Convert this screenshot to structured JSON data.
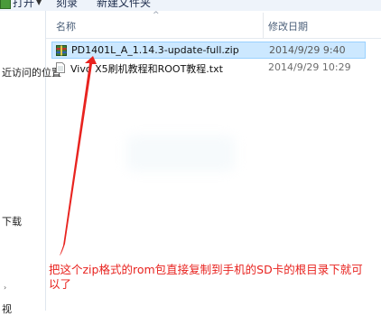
{
  "toolbar": {
    "open_label": "打开",
    "open_dropdown": "▼",
    "share_label": "刻录",
    "new_folder_label": "新建文件夹"
  },
  "sidebar": {
    "recent_places": "近访问的位置",
    "downloads": "下载",
    "item_bottom": "视"
  },
  "columns": {
    "name": "名称",
    "date_modified": "修改日期",
    "sort_indicator": "^"
  },
  "files": [
    {
      "name": "PD1401L_A_1.14.3-update-full.zip",
      "date": "2014/9/29 9:40",
      "type": "zip",
      "selected": true
    },
    {
      "name": "Vivo X5刷机教程和ROOT教程.txt",
      "date": "2014/9/29 10:29",
      "type": "txt",
      "selected": false
    }
  ],
  "annotation": {
    "text": "把这个zip格式的rom包直接复制到手机的SD卡的根目录下就可以了",
    "color": "#e8231f"
  },
  "colors": {
    "selection_bg": "#cce8ff",
    "annotation_red": "#e8231f"
  }
}
